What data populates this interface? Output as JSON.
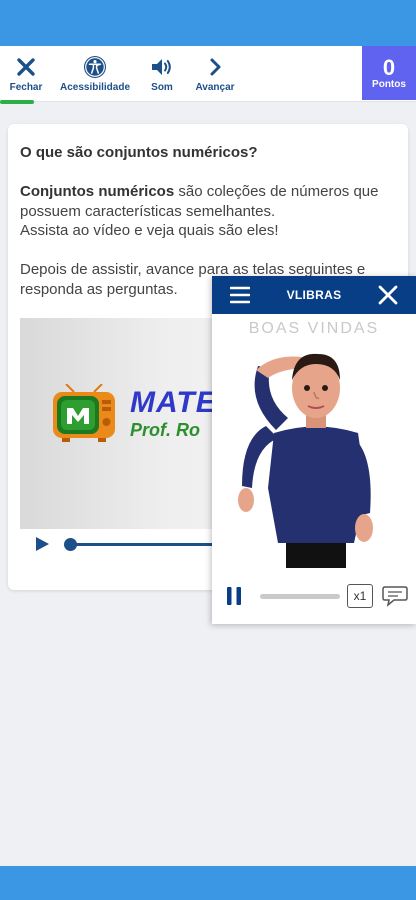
{
  "toolbar": {
    "close_label": "Fechar",
    "accessibility_label": "Acessibilidade",
    "sound_label": "Som",
    "next_label": "Avançar"
  },
  "points": {
    "value": "0",
    "label": "Pontos"
  },
  "card": {
    "title": "O que são conjuntos numéricos?",
    "intro_bold": "Conjuntos numéricos",
    "intro_rest": " são coleções de números que possuem características semelhantes.",
    "intro_line2": "Assista ao vídeo e veja quais são eles!",
    "instructions": "Depois de assistir, avance para as telas seguintes e responda as perguntas."
  },
  "video": {
    "brand_title": "MATE",
    "brand_subtitle": "Prof. Ro",
    "progress": 0.0
  },
  "vlibras": {
    "title": "VLIBRAS",
    "caption": "BOAS VINDAS",
    "speed": "x1"
  },
  "colors": {
    "status_bar": "#3b97e3",
    "toolbar_icon": "#1d4f88",
    "points_bg": "#5f63f0",
    "vlibras_header": "#073e86",
    "active_indicator": "#2cae4a"
  },
  "icons": [
    "close-icon",
    "accessibility-icon",
    "volume-icon",
    "chevron-right-icon",
    "menu-icon",
    "play-icon",
    "pause-icon",
    "chat-bubble-icon"
  ]
}
